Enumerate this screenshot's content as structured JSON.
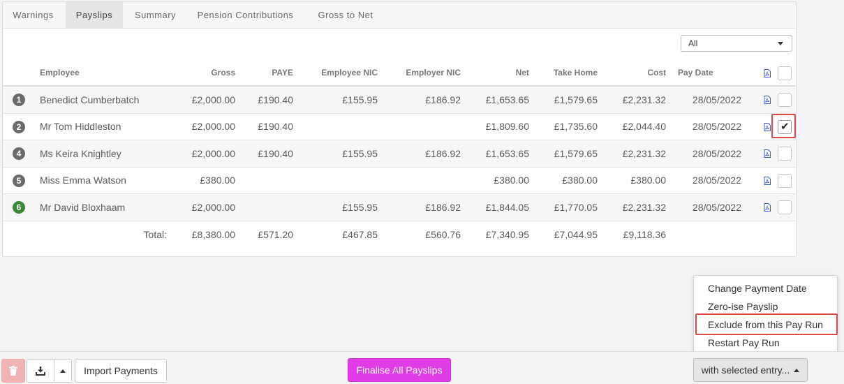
{
  "tabs": [
    "Warnings",
    "Payslips",
    "Summary",
    "Pension Contributions",
    "Gross to Net"
  ],
  "active_tab": "Payslips",
  "filter": {
    "selected": "All"
  },
  "table": {
    "headers": {
      "employee": "Employee",
      "gross": "Gross",
      "paye": "PAYE",
      "employee_nic": "Employee NIC",
      "employer_nic": "Employer NIC",
      "net": "Net",
      "take_home": "Take Home",
      "cost": "Cost",
      "pay_date": "Pay Date"
    },
    "rows": [
      {
        "num": "1",
        "status": "grey",
        "employee": "Benedict Cumberbatch",
        "gross": "£2,000.00",
        "paye": "£190.40",
        "employee_nic": "£155.95",
        "employer_nic": "£186.92",
        "net": "£1,653.65",
        "take_home": "£1,579.65",
        "cost": "£2,231.32",
        "pay_date": "28/05/2022",
        "checked": false
      },
      {
        "num": "2",
        "status": "grey",
        "employee": "Mr Tom Hiddleston",
        "gross": "£2,000.00",
        "paye": "£190.40",
        "employee_nic": "",
        "employer_nic": "",
        "net": "£1,809.60",
        "take_home": "£1,735.60",
        "cost": "£2,044.40",
        "pay_date": "28/05/2022",
        "checked": true
      },
      {
        "num": "4",
        "status": "grey",
        "employee": "Ms Keira Knightley",
        "gross": "£2,000.00",
        "paye": "£190.40",
        "employee_nic": "£155.95",
        "employer_nic": "£186.92",
        "net": "£1,653.65",
        "take_home": "£1,579.65",
        "cost": "£2,231.32",
        "pay_date": "28/05/2022",
        "checked": false
      },
      {
        "num": "5",
        "status": "grey",
        "employee": "Miss Emma Watson",
        "gross": "£380.00",
        "paye": "",
        "employee_nic": "",
        "employer_nic": "",
        "net": "£380.00",
        "take_home": "£380.00",
        "cost": "£380.00",
        "pay_date": "28/05/2022",
        "checked": false
      },
      {
        "num": "6",
        "status": "green",
        "employee": "Mr David Bloxhaam",
        "gross": "£2,000.00",
        "paye": "",
        "employee_nic": "£155.95",
        "employer_nic": "£186.92",
        "net": "£1,844.05",
        "take_home": "£1,770.05",
        "cost": "£2,231.32",
        "pay_date": "28/05/2022",
        "checked": false
      }
    ],
    "totals": {
      "label": "Total:",
      "gross": "£8,380.00",
      "paye": "£571.20",
      "employee_nic": "£467.85",
      "employer_nic": "£560.76",
      "net": "£7,340.95",
      "take_home": "£7,044.95",
      "cost": "£9,118.36"
    }
  },
  "context_menu": {
    "items": [
      "Change Payment Date",
      "Zero-ise Payslip",
      "Exclude from this Pay Run",
      "Restart Pay Run"
    ]
  },
  "footer": {
    "import_label": "Import Payments",
    "finalise_label": "Finalise All Payslips",
    "with_selected_label": "with selected entry..."
  },
  "colors": {
    "finalise": "#e03ce8",
    "highlight": "#e04848",
    "badge_grey": "#6b6b6b",
    "badge_green": "#3a8a3a",
    "pdf": "#3b5bd6"
  }
}
